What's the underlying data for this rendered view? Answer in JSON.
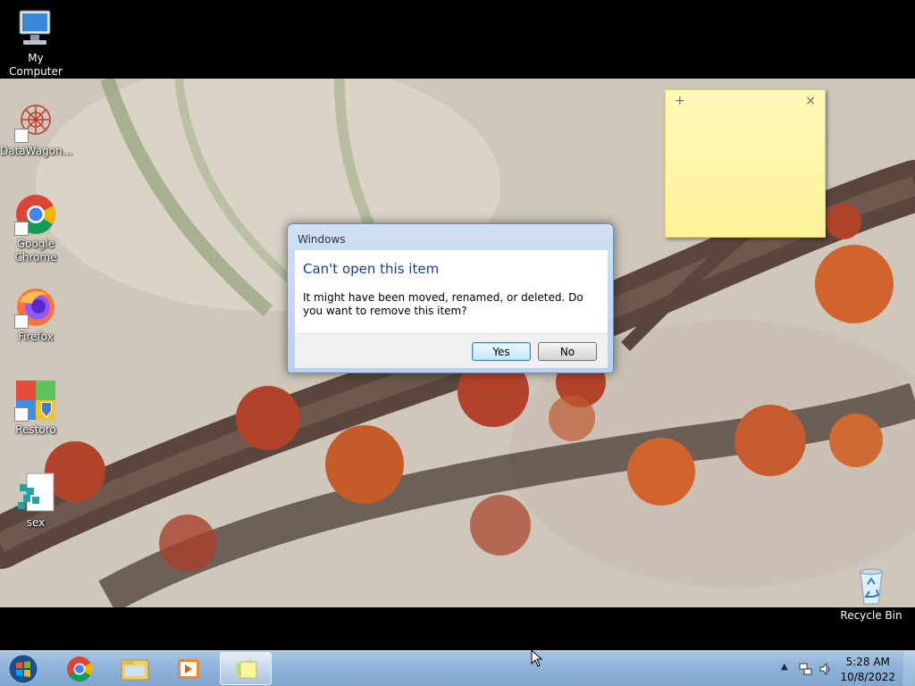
{
  "desktop": {
    "icons": [
      {
        "label": "My Computer"
      },
      {
        "label": "DataWagon..."
      },
      {
        "label": "Google Chrome"
      },
      {
        "label": "Firefox"
      },
      {
        "label": "Restoro"
      },
      {
        "label": "sex"
      },
      {
        "label": "Recycle Bin"
      }
    ]
  },
  "sticky_note": {
    "text": "",
    "add_glyph": "+",
    "close_glyph": "×",
    "color": "#fdf29a"
  },
  "dialog": {
    "title": "Windows",
    "heading": "Can't open this item",
    "message": "It might have been moved, renamed, or deleted. Do you want to remove this item?",
    "yes_label": "Yes",
    "no_label": "No"
  },
  "taskbar": {
    "pinned": [
      "start-orb",
      "chrome-icon",
      "explorer-icon",
      "media-player-icon",
      "sticky-notes-icon"
    ],
    "clock": {
      "time": "5:28 AM",
      "date": "10/8/2022"
    }
  },
  "colors": {
    "dialog_heading": "#1a3e8c",
    "taskbar": "#8fb3d9"
  }
}
